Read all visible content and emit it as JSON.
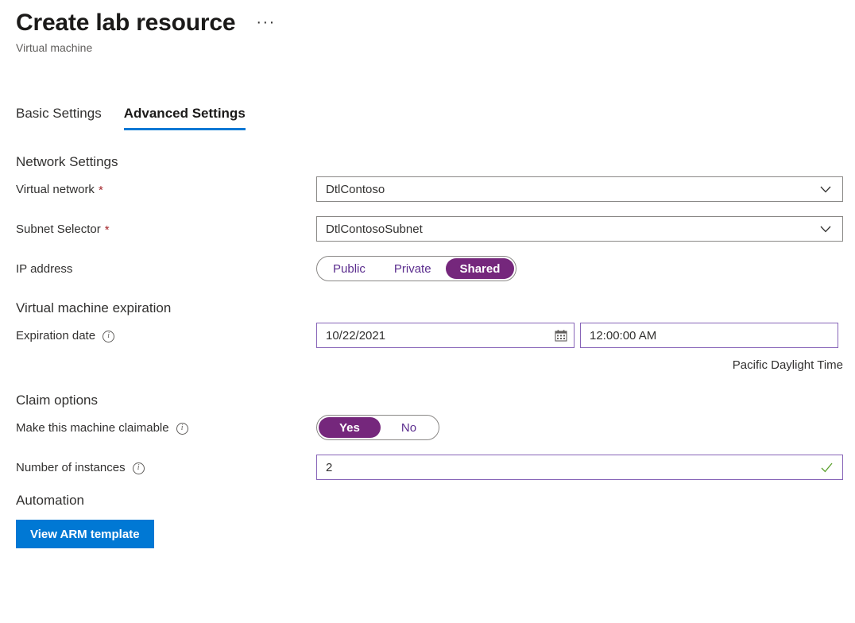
{
  "header": {
    "title": "Create lab resource",
    "subtitle": "Virtual machine",
    "more_menu": "···"
  },
  "tabs": [
    {
      "label": "Basic Settings",
      "active": false
    },
    {
      "label": "Advanced Settings",
      "active": true
    }
  ],
  "sections": {
    "network": {
      "heading": "Network Settings",
      "virtual_network": {
        "label": "Virtual network",
        "required_marker": "*",
        "value": "DtlContoso"
      },
      "subnet_selector": {
        "label": "Subnet Selector",
        "required_marker": "*",
        "value": "DtlContosoSubnet"
      },
      "ip_address": {
        "label": "IP address",
        "options": [
          "Public",
          "Private",
          "Shared"
        ],
        "selected": "Shared"
      }
    },
    "expiration": {
      "heading": "Virtual machine expiration",
      "expiration_date": {
        "label": "Expiration date",
        "info": "ⓘ",
        "date_value": "10/22/2021",
        "time_value": "12:00:00 AM",
        "timezone_note": "Pacific Daylight Time"
      }
    },
    "claim": {
      "heading": "Claim options",
      "claimable": {
        "label": "Make this machine claimable",
        "options": [
          "Yes",
          "No"
        ],
        "selected": "Yes"
      },
      "instances": {
        "label": "Number of instances",
        "value": "2"
      }
    },
    "automation": {
      "heading": "Automation",
      "view_arm_template": "View ARM template"
    }
  },
  "colors": {
    "accent_blue": "#0078d4",
    "selected_purple": "#75277c",
    "input_purple_border": "#8764b8",
    "required_red": "#a4262c",
    "valid_green": "#5aa02c"
  }
}
